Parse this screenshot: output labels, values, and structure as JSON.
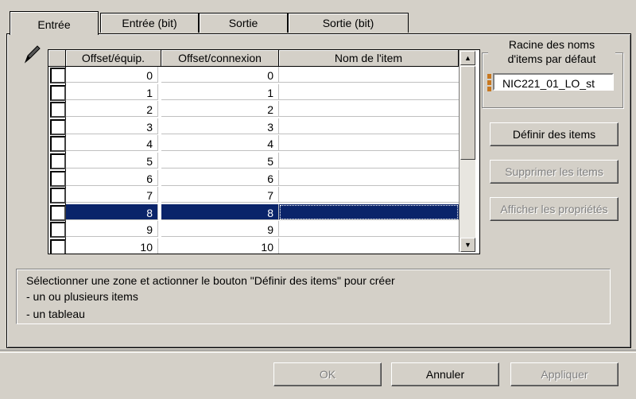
{
  "tabs": [
    {
      "label": "Entrée"
    },
    {
      "label": "Entrée (bit)"
    },
    {
      "label": "Sortie"
    },
    {
      "label": "Sortie (bit)"
    }
  ],
  "grid": {
    "columns": [
      "Offset/équip.",
      "Offset/connexion",
      "Nom de l'item"
    ],
    "rows": [
      {
        "offset_equip": "0",
        "offset_conn": "0",
        "name": ""
      },
      {
        "offset_equip": "1",
        "offset_conn": "1",
        "name": ""
      },
      {
        "offset_equip": "2",
        "offset_conn": "2",
        "name": ""
      },
      {
        "offset_equip": "3",
        "offset_conn": "3",
        "name": ""
      },
      {
        "offset_equip": "4",
        "offset_conn": "4",
        "name": ""
      },
      {
        "offset_equip": "5",
        "offset_conn": "5",
        "name": ""
      },
      {
        "offset_equip": "6",
        "offset_conn": "6",
        "name": ""
      },
      {
        "offset_equip": "7",
        "offset_conn": "7",
        "name": ""
      },
      {
        "offset_equip": "8",
        "offset_conn": "8",
        "name": "",
        "selected": true
      },
      {
        "offset_equip": "9",
        "offset_conn": "9",
        "name": ""
      },
      {
        "offset_equip": "10",
        "offset_conn": "10",
        "name": ""
      }
    ]
  },
  "root_group": {
    "title_line1": "Racine des noms",
    "title_line2": "d'items par défaut",
    "value": "NIC221_01_LO_st"
  },
  "buttons": {
    "define": "Définir des items",
    "delete": "Supprimer les items",
    "properties": "Afficher les propriétés",
    "ok": "OK",
    "cancel": "Annuler",
    "apply": "Appliquer"
  },
  "info": {
    "line1": "Sélectionner une zone et actionner le bouton \"Définir des items\" pour créer",
    "line2": "- un ou plusieurs items",
    "line3": "- un tableau"
  },
  "colors": {
    "selection": "#0a246a",
    "background": "#d4d0c8"
  }
}
